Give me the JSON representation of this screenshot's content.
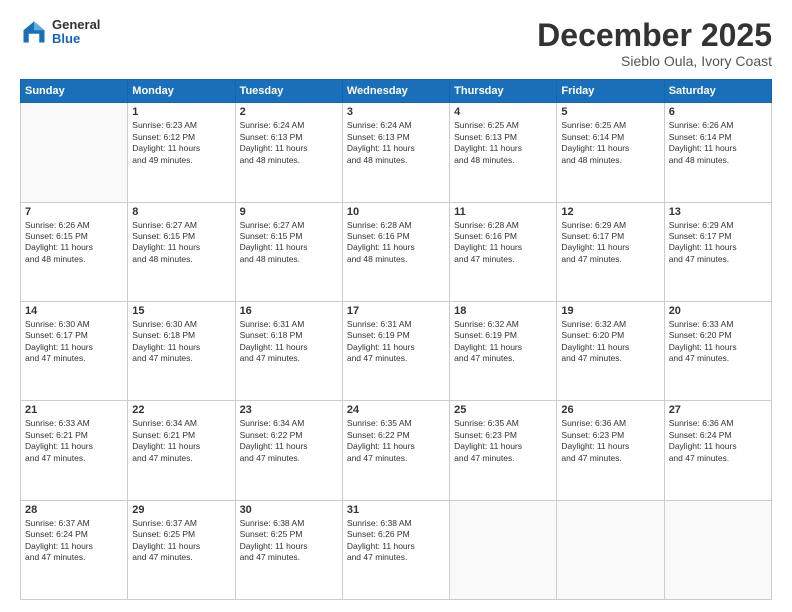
{
  "header": {
    "logo_general": "General",
    "logo_blue": "Blue",
    "month": "December 2025",
    "location": "Sieblo Oula, Ivory Coast"
  },
  "days_of_week": [
    "Sunday",
    "Monday",
    "Tuesday",
    "Wednesday",
    "Thursday",
    "Friday",
    "Saturday"
  ],
  "weeks": [
    [
      {
        "day": "",
        "info": ""
      },
      {
        "day": "1",
        "info": "Sunrise: 6:23 AM\nSunset: 6:12 PM\nDaylight: 11 hours\nand 49 minutes."
      },
      {
        "day": "2",
        "info": "Sunrise: 6:24 AM\nSunset: 6:13 PM\nDaylight: 11 hours\nand 48 minutes."
      },
      {
        "day": "3",
        "info": "Sunrise: 6:24 AM\nSunset: 6:13 PM\nDaylight: 11 hours\nand 48 minutes."
      },
      {
        "day": "4",
        "info": "Sunrise: 6:25 AM\nSunset: 6:13 PM\nDaylight: 11 hours\nand 48 minutes."
      },
      {
        "day": "5",
        "info": "Sunrise: 6:25 AM\nSunset: 6:14 PM\nDaylight: 11 hours\nand 48 minutes."
      },
      {
        "day": "6",
        "info": "Sunrise: 6:26 AM\nSunset: 6:14 PM\nDaylight: 11 hours\nand 48 minutes."
      }
    ],
    [
      {
        "day": "7",
        "info": "Sunrise: 6:26 AM\nSunset: 6:15 PM\nDaylight: 11 hours\nand 48 minutes."
      },
      {
        "day": "8",
        "info": "Sunrise: 6:27 AM\nSunset: 6:15 PM\nDaylight: 11 hours\nand 48 minutes."
      },
      {
        "day": "9",
        "info": "Sunrise: 6:27 AM\nSunset: 6:15 PM\nDaylight: 11 hours\nand 48 minutes."
      },
      {
        "day": "10",
        "info": "Sunrise: 6:28 AM\nSunset: 6:16 PM\nDaylight: 11 hours\nand 48 minutes."
      },
      {
        "day": "11",
        "info": "Sunrise: 6:28 AM\nSunset: 6:16 PM\nDaylight: 11 hours\nand 47 minutes."
      },
      {
        "day": "12",
        "info": "Sunrise: 6:29 AM\nSunset: 6:17 PM\nDaylight: 11 hours\nand 47 minutes."
      },
      {
        "day": "13",
        "info": "Sunrise: 6:29 AM\nSunset: 6:17 PM\nDaylight: 11 hours\nand 47 minutes."
      }
    ],
    [
      {
        "day": "14",
        "info": "Sunrise: 6:30 AM\nSunset: 6:17 PM\nDaylight: 11 hours\nand 47 minutes."
      },
      {
        "day": "15",
        "info": "Sunrise: 6:30 AM\nSunset: 6:18 PM\nDaylight: 11 hours\nand 47 minutes."
      },
      {
        "day": "16",
        "info": "Sunrise: 6:31 AM\nSunset: 6:18 PM\nDaylight: 11 hours\nand 47 minutes."
      },
      {
        "day": "17",
        "info": "Sunrise: 6:31 AM\nSunset: 6:19 PM\nDaylight: 11 hours\nand 47 minutes."
      },
      {
        "day": "18",
        "info": "Sunrise: 6:32 AM\nSunset: 6:19 PM\nDaylight: 11 hours\nand 47 minutes."
      },
      {
        "day": "19",
        "info": "Sunrise: 6:32 AM\nSunset: 6:20 PM\nDaylight: 11 hours\nand 47 minutes."
      },
      {
        "day": "20",
        "info": "Sunrise: 6:33 AM\nSunset: 6:20 PM\nDaylight: 11 hours\nand 47 minutes."
      }
    ],
    [
      {
        "day": "21",
        "info": "Sunrise: 6:33 AM\nSunset: 6:21 PM\nDaylight: 11 hours\nand 47 minutes."
      },
      {
        "day": "22",
        "info": "Sunrise: 6:34 AM\nSunset: 6:21 PM\nDaylight: 11 hours\nand 47 minutes."
      },
      {
        "day": "23",
        "info": "Sunrise: 6:34 AM\nSunset: 6:22 PM\nDaylight: 11 hours\nand 47 minutes."
      },
      {
        "day": "24",
        "info": "Sunrise: 6:35 AM\nSunset: 6:22 PM\nDaylight: 11 hours\nand 47 minutes."
      },
      {
        "day": "25",
        "info": "Sunrise: 6:35 AM\nSunset: 6:23 PM\nDaylight: 11 hours\nand 47 minutes."
      },
      {
        "day": "26",
        "info": "Sunrise: 6:36 AM\nSunset: 6:23 PM\nDaylight: 11 hours\nand 47 minutes."
      },
      {
        "day": "27",
        "info": "Sunrise: 6:36 AM\nSunset: 6:24 PM\nDaylight: 11 hours\nand 47 minutes."
      }
    ],
    [
      {
        "day": "28",
        "info": "Sunrise: 6:37 AM\nSunset: 6:24 PM\nDaylight: 11 hours\nand 47 minutes."
      },
      {
        "day": "29",
        "info": "Sunrise: 6:37 AM\nSunset: 6:25 PM\nDaylight: 11 hours\nand 47 minutes."
      },
      {
        "day": "30",
        "info": "Sunrise: 6:38 AM\nSunset: 6:25 PM\nDaylight: 11 hours\nand 47 minutes."
      },
      {
        "day": "31",
        "info": "Sunrise: 6:38 AM\nSunset: 6:26 PM\nDaylight: 11 hours\nand 47 minutes."
      },
      {
        "day": "",
        "info": ""
      },
      {
        "day": "",
        "info": ""
      },
      {
        "day": "",
        "info": ""
      }
    ]
  ]
}
